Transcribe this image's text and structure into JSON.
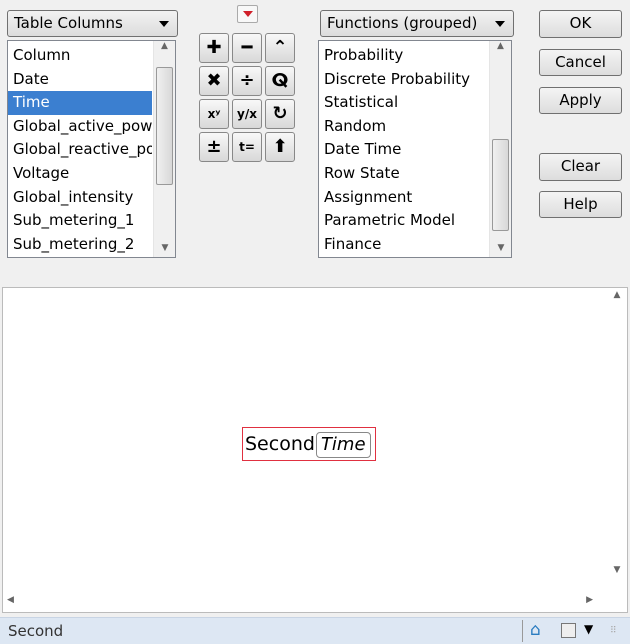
{
  "columns_dropdown": {
    "label": "Table Columns"
  },
  "columns": [
    "Column",
    "Date",
    "Time",
    "Global_active_power",
    "Global_reactive_power",
    "Voltage",
    "Global_intensity",
    "Sub_metering_1",
    "Sub_metering_2"
  ],
  "selected_column": "Time",
  "functions_dropdown": {
    "label": "Functions (grouped)"
  },
  "functions": [
    "Probability",
    "Discrete Probability",
    "Statistical",
    "Random",
    "Date Time",
    "Row State",
    "Assignment",
    "Parametric Model",
    "Finance"
  ],
  "operators": [
    {
      "name": "plus-icon",
      "glyph": "✚"
    },
    {
      "name": "minus-icon",
      "glyph": "━"
    },
    {
      "name": "caret-up-icon",
      "glyph": "⌃"
    },
    {
      "name": "multiply-icon",
      "glyph": "✖"
    },
    {
      "name": "divide-icon",
      "glyph": "÷"
    },
    {
      "name": "root-icon",
      "glyph": "ⵕ"
    },
    {
      "name": "power-icon",
      "glyph": "xʸ"
    },
    {
      "name": "fraction-icon",
      "glyph": "y/x"
    },
    {
      "name": "refresh-icon",
      "glyph": "↻"
    },
    {
      "name": "plus-minus-icon",
      "glyph": "±"
    },
    {
      "name": "assign-icon",
      "glyph": "t="
    },
    {
      "name": "up-arrow-icon",
      "glyph": "⬆"
    }
  ],
  "buttons": {
    "ok": "OK",
    "cancel": "Cancel",
    "apply": "Apply",
    "clear": "Clear",
    "help": "Help"
  },
  "formula": {
    "function": "Second",
    "argument": "Time"
  },
  "status": {
    "text": "Second"
  },
  "colors": {
    "selection": "#3b7fd0",
    "formula_box": "#e03040",
    "status_bar": "#dde7f3"
  }
}
